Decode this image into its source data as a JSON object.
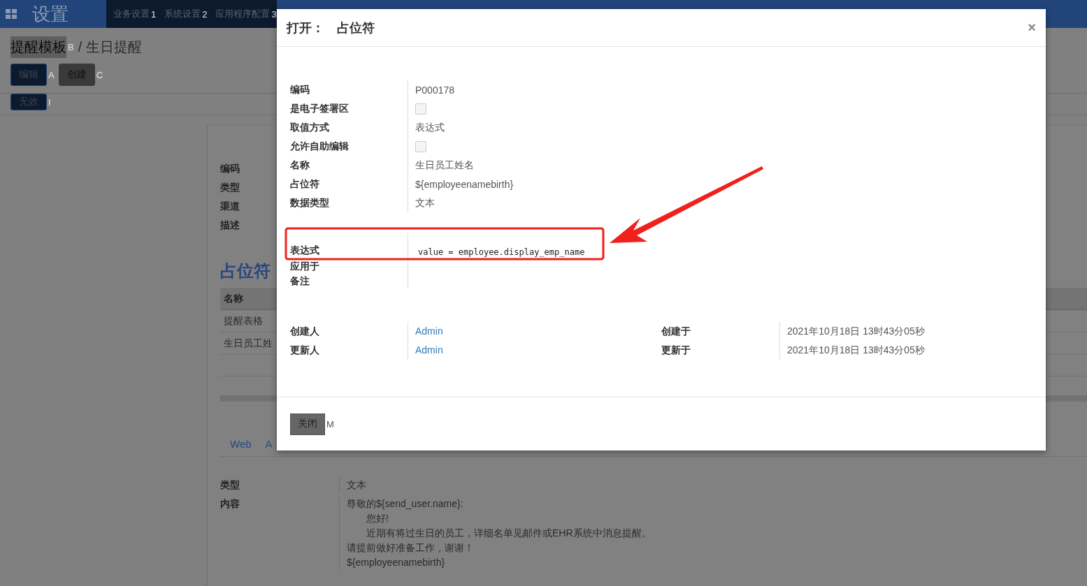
{
  "app_bar": {
    "title": "设置",
    "menu": [
      {
        "label": "业务设置",
        "hotkey": "1"
      },
      {
        "label": "系统设置",
        "hotkey": "2"
      },
      {
        "label": "应用程序配置",
        "hotkey": "3"
      }
    ]
  },
  "breadcrumb": {
    "parent": {
      "label": "提醒模板",
      "hotkey": "B"
    },
    "separator": "/",
    "current": "生日提醒"
  },
  "actions": [
    {
      "label": "编辑",
      "hotkey": "A",
      "kind": "primary"
    },
    {
      "label": "创建",
      "hotkey": "C",
      "kind": "secondary"
    }
  ],
  "status_actions": [
    {
      "label": "无效",
      "hotkey": "I",
      "kind": "primary"
    }
  ],
  "sheet": {
    "fields": [
      "编码",
      "类型",
      "渠道",
      "描述"
    ],
    "section_title": "占位符",
    "table": {
      "columns": [
        "名称"
      ],
      "rows": [
        [
          "提醒表格"
        ],
        [
          "生日员工姓"
        ]
      ]
    },
    "tabs": [
      {
        "label": "Web"
      },
      {
        "label": "A"
      }
    ],
    "detail_fields": [
      {
        "label": "类型",
        "lines": [
          {
            "text": "文本",
            "indented": false
          }
        ]
      },
      {
        "label": "内容",
        "lines": [
          {
            "text": "尊敬的${send_user.name}:",
            "indented": false
          },
          {
            "text": "您好!",
            "indented": true
          },
          {
            "text": "近期有将过生日的员工，详细名单见邮件或EHR系统中消息提醒。",
            "indented": true
          },
          {
            "text": "请提前做好准备工作，谢谢！",
            "indented": false
          },
          {
            "text": "${employeenamebirth}",
            "indented": false
          }
        ]
      }
    ]
  },
  "dialog": {
    "title": "打开：　占位符",
    "close": "×",
    "groups": [
      [
        {
          "label": "编码",
          "kind": "text",
          "value": "P000178"
        },
        {
          "label": "是电子签署区",
          "kind": "checkbox",
          "checked": false
        },
        {
          "label": "取值方式",
          "kind": "text",
          "value": "表达式"
        },
        {
          "label": "允许自助编辑",
          "kind": "checkbox",
          "checked": false
        },
        {
          "label": "名称",
          "kind": "text",
          "value": "生日员工姓名"
        },
        {
          "label": "占位符",
          "kind": "text",
          "value": "${employeenamebirth}"
        },
        {
          "label": "数据类型",
          "kind": "text",
          "value": "文本"
        }
      ],
      [
        {
          "label": "表达式",
          "kind": "code",
          "value": "value = employee.display_emp_name"
        },
        {
          "label": "应用于",
          "kind": "text"
        },
        {
          "label": "备注",
          "kind": "text"
        }
      ]
    ],
    "meta": [
      [
        {
          "label": "创建人",
          "kind": "link",
          "value": "Admin"
        },
        {
          "label": "更新人",
          "kind": "link",
          "value": "Admin"
        }
      ],
      [
        {
          "label": "创建于",
          "kind": "text",
          "value": "2021年10月18日 13时43分05秒"
        },
        {
          "label": "更新于",
          "kind": "text",
          "value": "2021年10月18日 13时43分05秒"
        }
      ]
    ],
    "footer_button": {
      "label": "关闭",
      "hotkey": "M"
    }
  }
}
